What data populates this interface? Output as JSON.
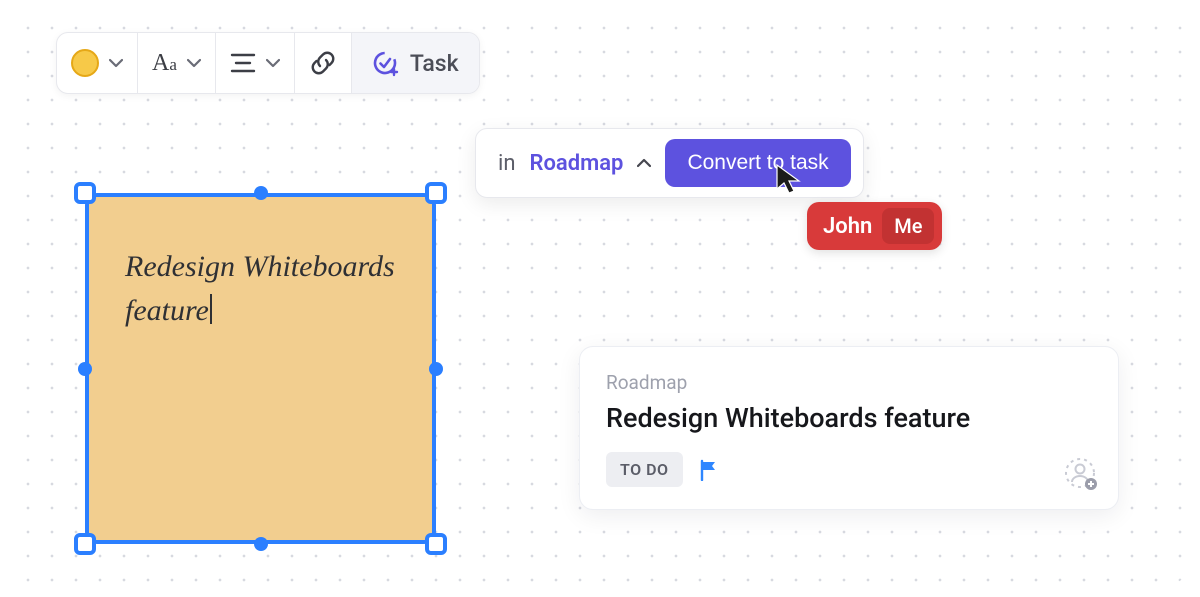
{
  "toolbar": {
    "color": "#f7c948",
    "text_tool": "Aa",
    "task_label": "Task"
  },
  "sticky": {
    "text": "Redesign Whiteboards feature"
  },
  "convert": {
    "in_label": "in",
    "list_name": "Roadmap",
    "button_label": "Convert to task"
  },
  "collab": {
    "user": "John",
    "me_label": "Me"
  },
  "task_card": {
    "list": "Roadmap",
    "title": "Redesign Whiteboards feature",
    "status": "TO DO"
  }
}
